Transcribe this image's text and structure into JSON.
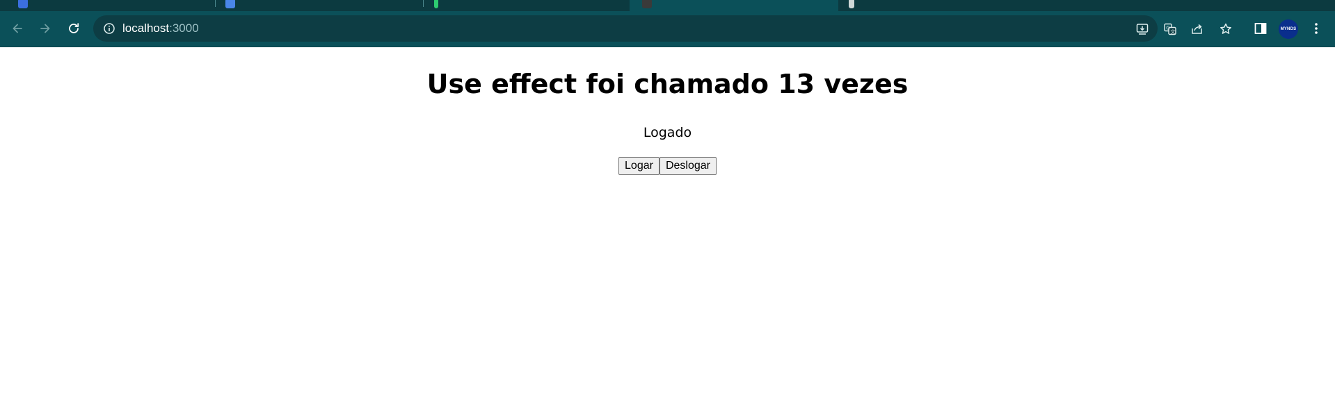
{
  "browser": {
    "url": {
      "host": "localhost",
      "port": ":3000"
    },
    "profile": {
      "avatar_text": "MYNDS"
    },
    "colors": {
      "chrome": "#0b5059",
      "tabstrip": "#0c3a40",
      "omnibox": "#0d3d44"
    }
  },
  "page": {
    "heading": "Use effect foi chamado 13 vezes",
    "status": "Logado",
    "buttons": {
      "login_label": "Logar",
      "logout_label": "Deslogar"
    }
  }
}
